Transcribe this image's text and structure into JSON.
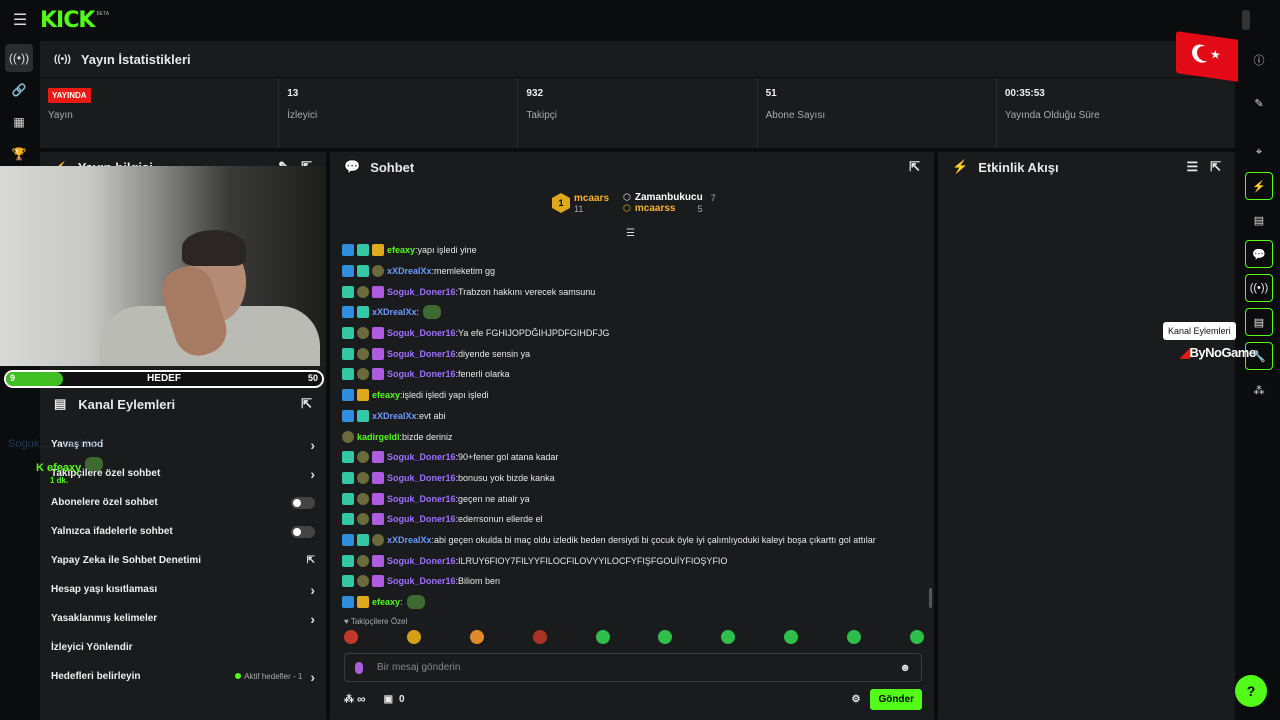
{
  "brand": {
    "logo": "KICK",
    "beta": "BETA"
  },
  "stats": {
    "title": "Yayın İstatistikleri",
    "items": [
      {
        "badge": "YAYINDA",
        "label": "Yayın"
      },
      {
        "value": "13",
        "label": "İzleyici"
      },
      {
        "value": "932",
        "label": "Takipçi"
      },
      {
        "value": "51",
        "label": "Abone Sayısı"
      },
      {
        "value": "00:35:53",
        "label": "Yayında Olduğu Süre"
      }
    ]
  },
  "info": {
    "title": "Yayın bilgisi"
  },
  "goal": {
    "current": "9",
    "label": "HEDEF",
    "target": "50",
    "progress_fraction": 0.18
  },
  "kanal": {
    "title": "Kanal Eylemleri",
    "actions": [
      {
        "label": "Yavaş mod",
        "control": "chevron"
      },
      {
        "label": "Takipçilere özel sohbet",
        "control": "chevron"
      },
      {
        "label": "Abonelere özel sohbet",
        "control": "toggle"
      },
      {
        "label": "Yalnızca ifadelerle sohbet",
        "control": "toggle"
      },
      {
        "label": "Yapay Zeka ile Sohbet Denetimi",
        "control": "external"
      },
      {
        "label": "Hesap yaşı kısıtlaması",
        "control": "chevron"
      },
      {
        "label": "Yasaklanmış kelimeler",
        "control": "chevron"
      },
      {
        "label": "İzleyici Yönlendir",
        "control": "none"
      },
      {
        "label": "Hedefleri belirleyin",
        "control": "chevron",
        "extra": "Aktif hedefler - 1"
      }
    ]
  },
  "overlay": {
    "ghost": "Soguk... ... ram ben",
    "name": "efeaxy",
    "time": "1 dk."
  },
  "chat": {
    "title": "Sohbet",
    "leaderboard": [
      {
        "rank": "1",
        "name": "mcaars",
        "count": "11"
      },
      {
        "name": "Zamanbukucu",
        "count": "7"
      },
      {
        "name": "mcaarss",
        "count": "5"
      }
    ],
    "messages": [
      {
        "user": "efeaxy",
        "color": "g",
        "badges": [
          "mod",
          "vip",
          "gold"
        ],
        "text": "yapı işledi yine"
      },
      {
        "user": "xXDrealXx",
        "color": "bl",
        "badges": [
          "mod",
          "vip",
          "og"
        ],
        "text": "memleketim gg"
      },
      {
        "user": "Soguk_Doner16",
        "color": "p",
        "badges": [
          "vip",
          "og",
          "sub"
        ],
        "text": "Trabzon hakkını verecek samsunu"
      },
      {
        "user": "xXDrealXx",
        "color": "bl",
        "badges": [
          "mod",
          "vip"
        ],
        "text": "",
        "emote": true
      },
      {
        "user": "Soguk_Doner16",
        "color": "p",
        "badges": [
          "vip",
          "og",
          "sub"
        ],
        "text": "Ya efe FGHIJOPDĞIHJPDFGIHDFJG"
      },
      {
        "user": "Soguk_Doner16",
        "color": "p",
        "badges": [
          "vip",
          "og",
          "sub"
        ],
        "text": "diyende sensin ya"
      },
      {
        "user": "Soguk_Doner16",
        "color": "p",
        "badges": [
          "vip",
          "og",
          "sub"
        ],
        "text": "fenerli olarka"
      },
      {
        "user": "efeaxy",
        "color": "g",
        "badges": [
          "mod",
          "gold"
        ],
        "text": "işledi işledi yapı işledi"
      },
      {
        "user": "xXDrealXx",
        "color": "bl",
        "badges": [
          "mod",
          "vip"
        ],
        "text": "evt abi"
      },
      {
        "user": "kadirgeldi",
        "color": "g",
        "badges": [
          "og"
        ],
        "text": "bizde deriniz"
      },
      {
        "user": "Soguk_Doner16",
        "color": "p",
        "badges": [
          "vip",
          "og",
          "sub"
        ],
        "text": "90+fener gol atana kadar"
      },
      {
        "user": "Soguk_Doner16",
        "color": "p",
        "badges": [
          "vip",
          "og",
          "sub"
        ],
        "text": "bonusu yok bizde kanka"
      },
      {
        "user": "Soguk_Doner16",
        "color": "p",
        "badges": [
          "vip",
          "og",
          "sub"
        ],
        "text": "geçen ne atıalr ya"
      },
      {
        "user": "Soguk_Doner16",
        "color": "p",
        "badges": [
          "vip",
          "og",
          "sub"
        ],
        "text": "ederrsonun ellerde el"
      },
      {
        "user": "xXDrealXx",
        "color": "bl",
        "badges": [
          "mod",
          "vip",
          "og"
        ],
        "text": "abi geçen okulda bi maç oldu izledik beden dersiydi bi çocuk öyle iyi çalımlıyoduki kaleyi boşa çıkarttı gol attılar"
      },
      {
        "user": "Soguk_Doner16",
        "color": "p",
        "badges": [
          "vip",
          "og",
          "sub"
        ],
        "text": "ILRUY6FIOY7FILYYFILOCFILOVYYILOCFYFIŞFGOUİYFIOŞYFIO"
      },
      {
        "user": "Soguk_Doner16",
        "color": "p",
        "badges": [
          "vip",
          "og",
          "sub"
        ],
        "text": "Biliom ben"
      },
      {
        "user": "efeaxy",
        "color": "g",
        "badges": [
          "mod",
          "gold"
        ],
        "text": "",
        "emote": true
      }
    ],
    "followers_only_label": "Takipçilere Özel",
    "input_placeholder": "Bir mesaj gönderin",
    "footer": {
      "infinity": "∞",
      "count": "0",
      "send": "Gönder"
    }
  },
  "events": {
    "title": "Etkinlik Akışı"
  },
  "tooltip": "Kanal Eylemleri",
  "watermark": "ByNoGame",
  "colors": {
    "accent": "#53fc18",
    "live": "#e91916",
    "panel": "#191b1c",
    "bg": "#0b0c0d"
  }
}
